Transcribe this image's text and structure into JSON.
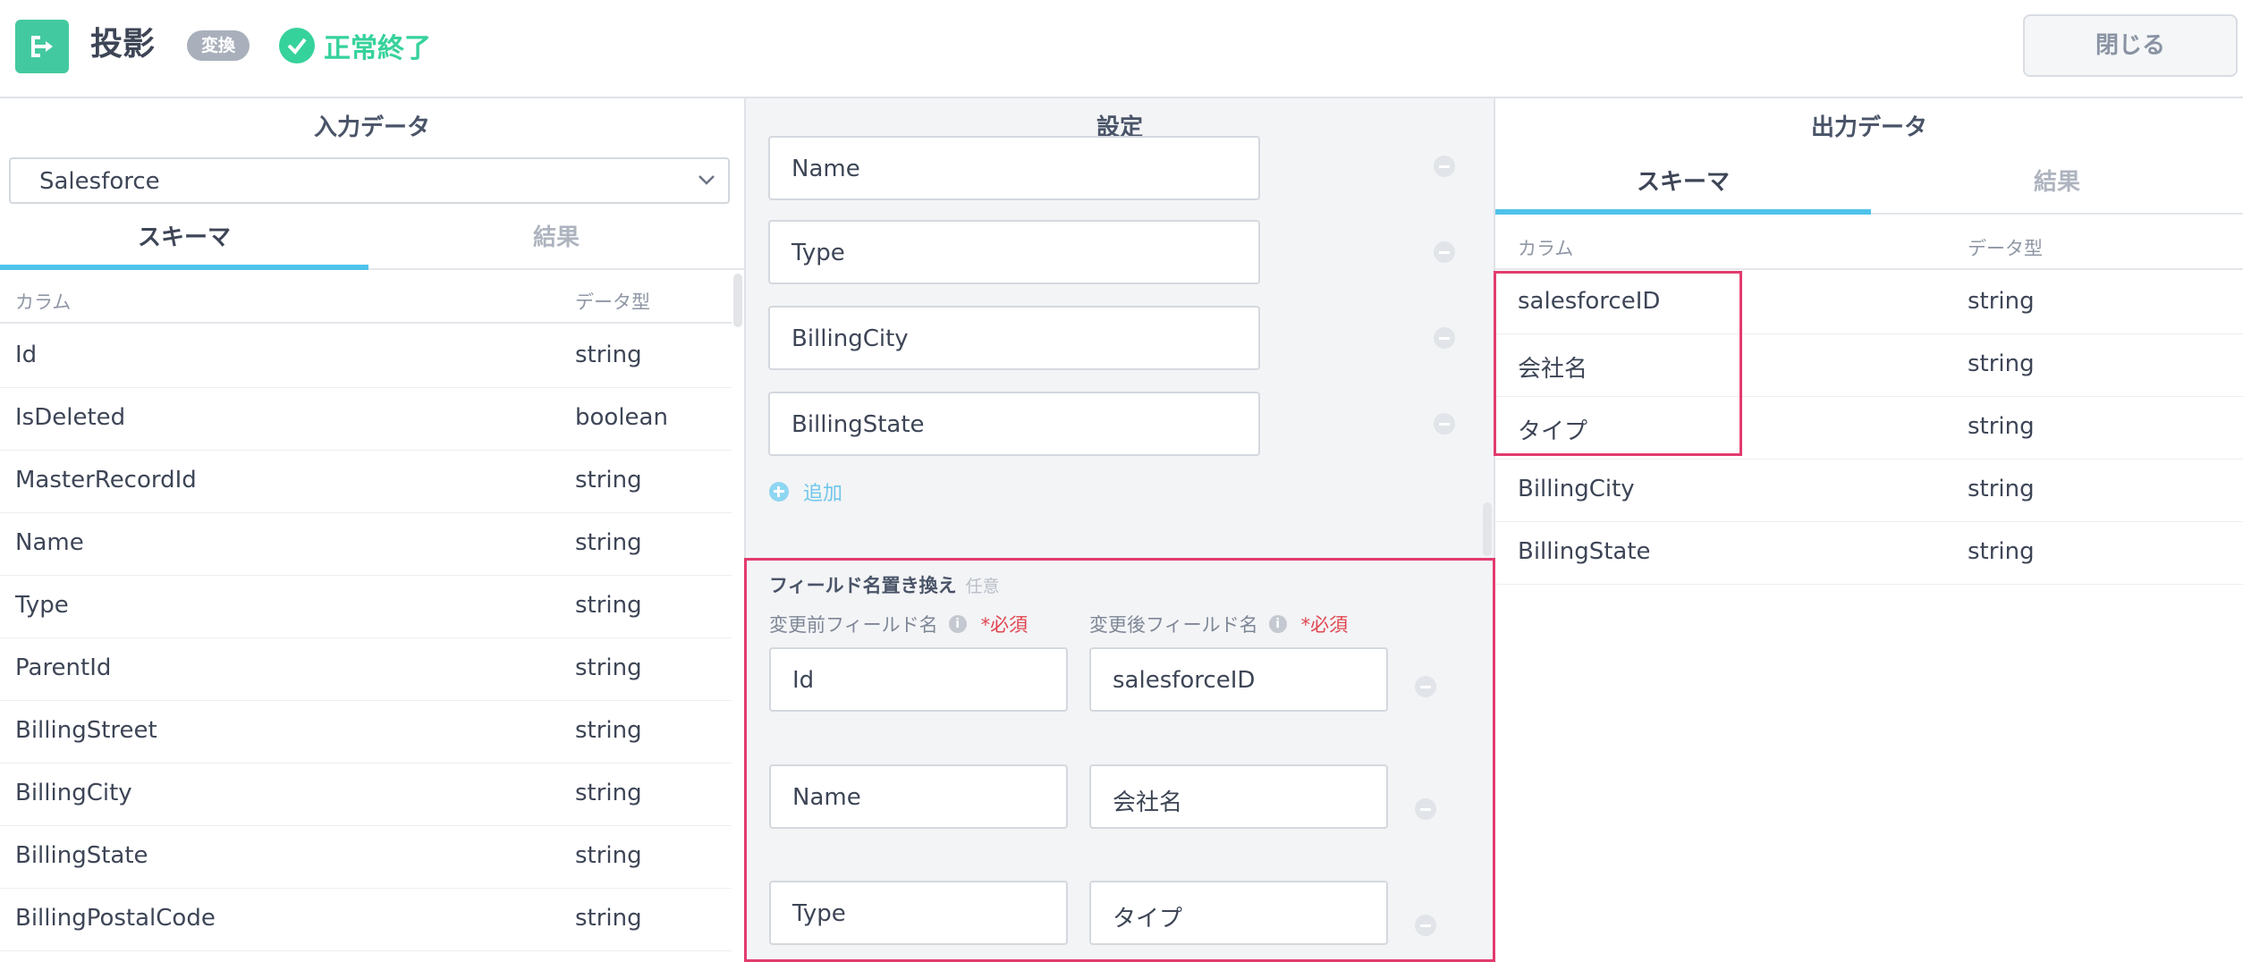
{
  "header": {
    "title": "投影",
    "badge": "変換",
    "status": "正常終了",
    "close_label": "閉じる"
  },
  "left": {
    "title": "入力データ",
    "source_select": "Salesforce",
    "tabs": [
      "スキーマ",
      "結果"
    ],
    "columns": [
      "カラム",
      "データ型"
    ],
    "rows": [
      {
        "name": "Id",
        "type": "string"
      },
      {
        "name": "IsDeleted",
        "type": "boolean"
      },
      {
        "name": "MasterRecordId",
        "type": "string"
      },
      {
        "name": "Name",
        "type": "string"
      },
      {
        "name": "Type",
        "type": "string"
      },
      {
        "name": "ParentId",
        "type": "string"
      },
      {
        "name": "BillingStreet",
        "type": "string"
      },
      {
        "name": "BillingCity",
        "type": "string"
      },
      {
        "name": "BillingState",
        "type": "string"
      },
      {
        "name": "BillingPostalCode",
        "type": "string"
      }
    ]
  },
  "middle": {
    "title": "設定",
    "fields": [
      "Name",
      "Type",
      "BillingCity",
      "BillingState"
    ],
    "add_label": "追加",
    "rename": {
      "label": "フィールド名置き換え",
      "optional": "任意",
      "before_label": "変更前フィールド名",
      "after_label": "変更後フィールド名",
      "required": "*必須",
      "pairs": [
        {
          "before": "Id",
          "after": "salesforceID"
        },
        {
          "before": "Name",
          "after": "会社名"
        },
        {
          "before": "Type",
          "after": "タイプ"
        }
      ]
    }
  },
  "right": {
    "title": "出力データ",
    "tabs": [
      "スキーマ",
      "結果"
    ],
    "columns": [
      "カラム",
      "データ型"
    ],
    "rows": [
      {
        "name": "salesforceID",
        "type": "string"
      },
      {
        "name": "会社名",
        "type": "string"
      },
      {
        "name": "タイプ",
        "type": "string"
      },
      {
        "name": "BillingCity",
        "type": "string"
      },
      {
        "name": "BillingState",
        "type": "string"
      }
    ]
  }
}
